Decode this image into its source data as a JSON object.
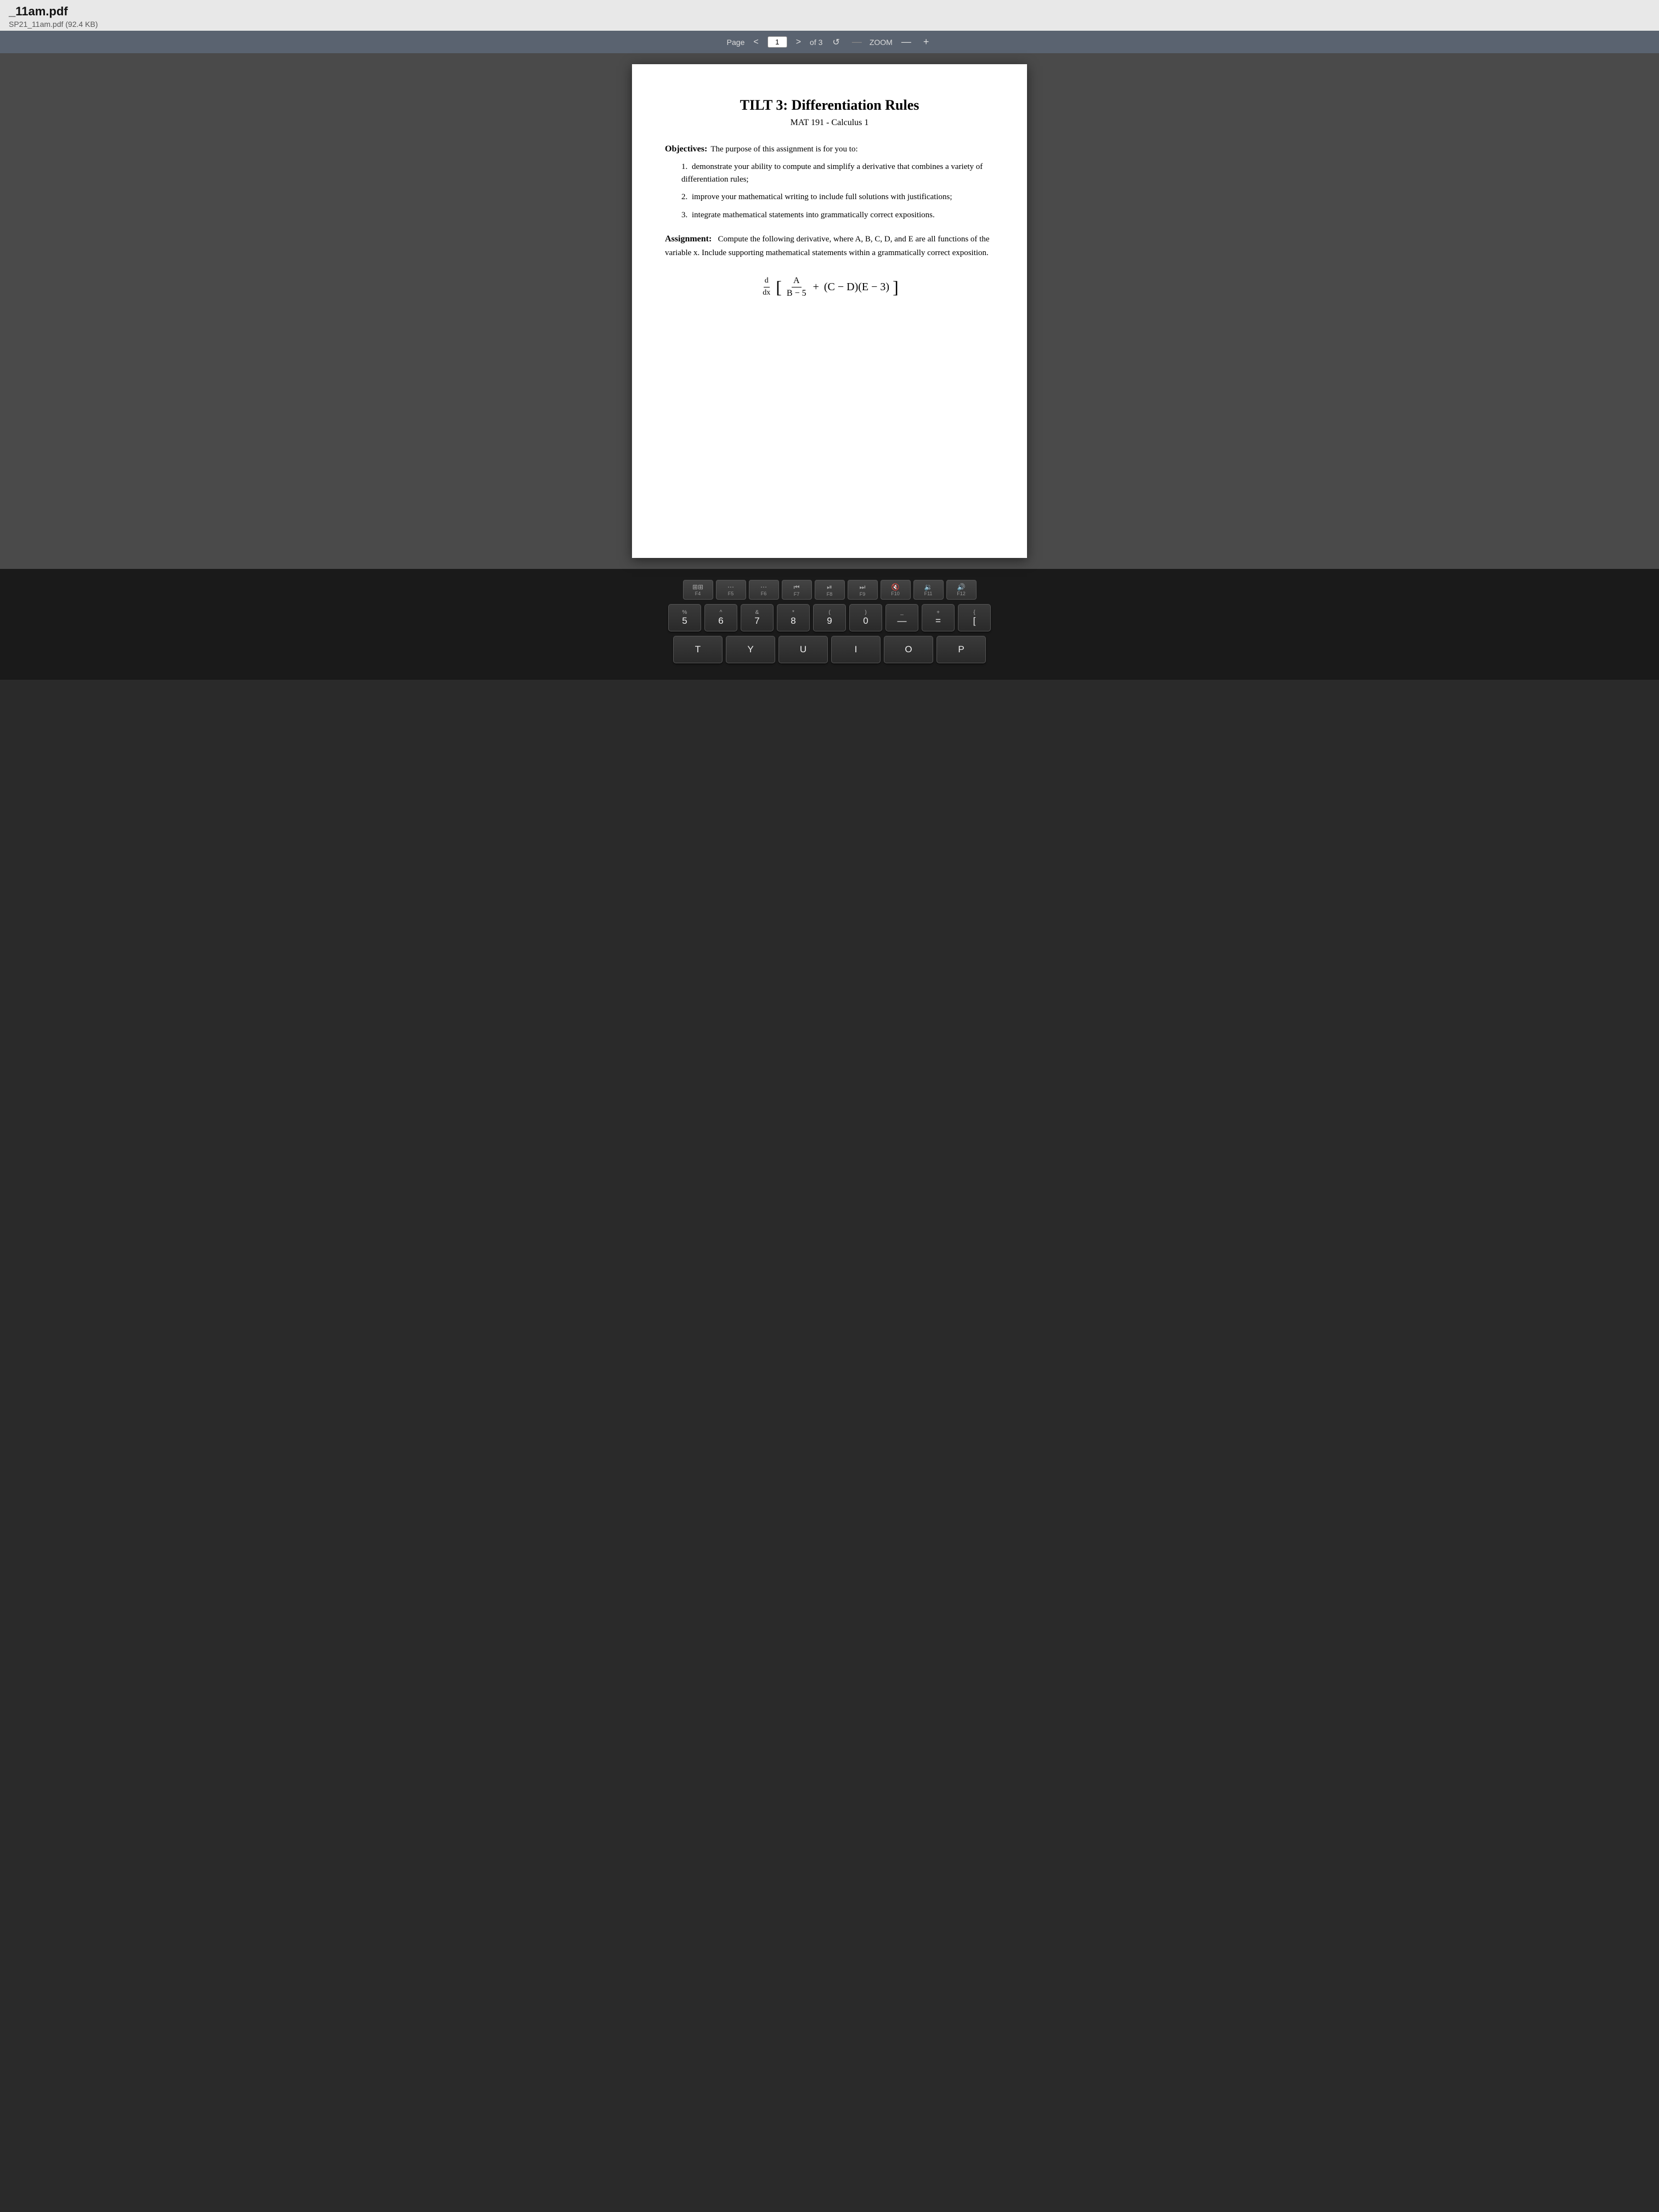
{
  "header": {
    "file_title": "_11am.pdf",
    "file_subtitle": "SP21_11am.pdf (92.4 KB)"
  },
  "toolbar": {
    "page_label": "Page",
    "prev_btn": "<",
    "next_btn": ">",
    "current_page": "1",
    "of_pages": "of 3",
    "reload_btn": "↺",
    "separator": "—",
    "zoom_label": "ZOOM",
    "zoom_minus": "—",
    "zoom_plus": "+"
  },
  "pdf": {
    "title": "TILT 3:  Differentiation Rules",
    "subtitle": "MAT 191 - Calculus 1",
    "objectives_label": "Objectives:",
    "objectives_intro": "The purpose of this assignment is for you to:",
    "objectives": [
      "demonstrate your ability to compute and simplify a derivative that combines a variety of differentiation rules;",
      "improve your mathematical writing to include full solutions with justifications;",
      "integrate mathematical statements into grammatically correct expositions."
    ],
    "assignment_label": "Assignment:",
    "assignment_text": "Compute the following derivative, where A, B, C, D, and E are all functions of the variable x. Include supporting mathematical statements within a grammatically correct exposition.",
    "formula_d": "d",
    "formula_dx": "dx",
    "formula_numerator": "A",
    "formula_denominator": "B − 5",
    "formula_rest": "+ (C − D)(E − 3)"
  },
  "keyboard": {
    "fn_row": [
      {
        "label": "F4",
        "icon": "⊞⊞⊞",
        "sub": ""
      },
      {
        "label": "F5",
        "icon": "···",
        "sub": ""
      },
      {
        "label": "F6",
        "icon": "···",
        "sub": ""
      },
      {
        "label": "F7",
        "icon": "◁◁",
        "sub": ""
      },
      {
        "label": "F8",
        "icon": "▷‖",
        "sub": ""
      },
      {
        "label": "F9",
        "icon": "▷▷",
        "sub": ""
      },
      {
        "label": "F10",
        "icon": "◁",
        "sub": ""
      },
      {
        "label": "F11",
        "icon": "◁)",
        "sub": ""
      },
      {
        "label": "F12",
        "icon": "◁))",
        "sub": ""
      }
    ],
    "number_row": [
      {
        "top": "%",
        "main": "5"
      },
      {
        "top": "^",
        "main": "6"
      },
      {
        "top": "&",
        "main": "7"
      },
      {
        "top": "*",
        "main": "8"
      },
      {
        "top": "(",
        "main": "9"
      },
      {
        "top": ")",
        "main": "0"
      },
      {
        "top": "_",
        "main": "—"
      },
      {
        "top": "+",
        "main": "="
      },
      {
        "top": "{",
        "main": "["
      }
    ],
    "letter_row": [
      {
        "main": "T"
      },
      {
        "main": "Y"
      },
      {
        "main": "U"
      },
      {
        "main": "I"
      },
      {
        "main": "O"
      },
      {
        "main": "P"
      }
    ]
  }
}
